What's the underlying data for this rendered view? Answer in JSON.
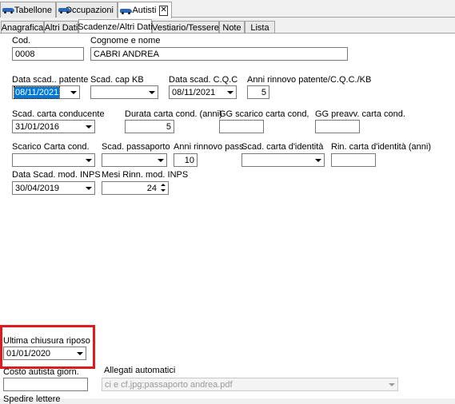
{
  "doc_tabs": [
    {
      "label": "Tabellone",
      "icon": "car-icon"
    },
    {
      "label": "Occupazioni",
      "icon": "car-icon"
    },
    {
      "label": "Autisti",
      "icon": "car-icon",
      "active": true
    }
  ],
  "doc_close": "✕",
  "sub_tabs": [
    "Anagrafica",
    "Altri Dati",
    "Scadenze/Altri Dati",
    "Vestiario/Tessere",
    "Note",
    "Lista"
  ],
  "form": {
    "cod_label": "Cod.",
    "cod_value": "0008",
    "name_label": "Cognome e nome",
    "name_value": "CABRI ANDREA",
    "scad_patente_label": "Data scad.. patente",
    "scad_patente_value": "08/11/2021",
    "scad_cap_kb_label": "Scad. cap KB",
    "scad_cap_kb_value": "",
    "scad_cqc_label": "Data scad. C.Q.C",
    "scad_cqc_value": "08/11/2021",
    "anni_rinnovo_label": "Anni rinnovo patente/C.Q.C./KB",
    "anni_rinnovo_value": "5",
    "scad_carta_cond_label": "Scad. carta conducente",
    "scad_carta_cond_value": "31/01/2016",
    "durata_carta_label": "Durata carta cond. (anni)",
    "durata_carta_value": "5",
    "gg_scarico_label": "GG scarico carta cond,",
    "gg_scarico_value": "",
    "gg_preavv_label": "GG preavv. carta cond.",
    "gg_preavv_value": "",
    "scarico_carta_label": "Scarico Carta cond.",
    "scarico_carta_value": "",
    "scad_passaporto_label": "Scad. passaporto",
    "scad_passaporto_value": "",
    "anni_rinnovo_pass_label": "Anni rinnovo pass.",
    "anni_rinnovo_pass_value": "10",
    "scad_identita_label": "Scad. carta d'identità",
    "scad_identita_value": "",
    "rin_identita_label": "Rin. carta d'identità (anni)",
    "rin_identita_value": "",
    "scad_inps_label": "Data Scad. mod. INPS",
    "scad_inps_value": "30/04/2019",
    "mesi_inps_label": "Mesi Rinn. mod. INPS",
    "mesi_inps_value": "24",
    "ultima_chiusura_label": "Ultima chiusura riposo",
    "ultima_chiusura_value": "01/01/2020",
    "costo_label": "Costo autista giorn.",
    "costo_value": "",
    "allegati_label": "Allegati automatici",
    "allegati_value": "ci e cf.jpg;passaporto andrea.pdf",
    "bottom_cut_label": "Spedire lettere"
  },
  "colors": {
    "accent": "#0078d7",
    "highlight": "#e01b1b"
  }
}
